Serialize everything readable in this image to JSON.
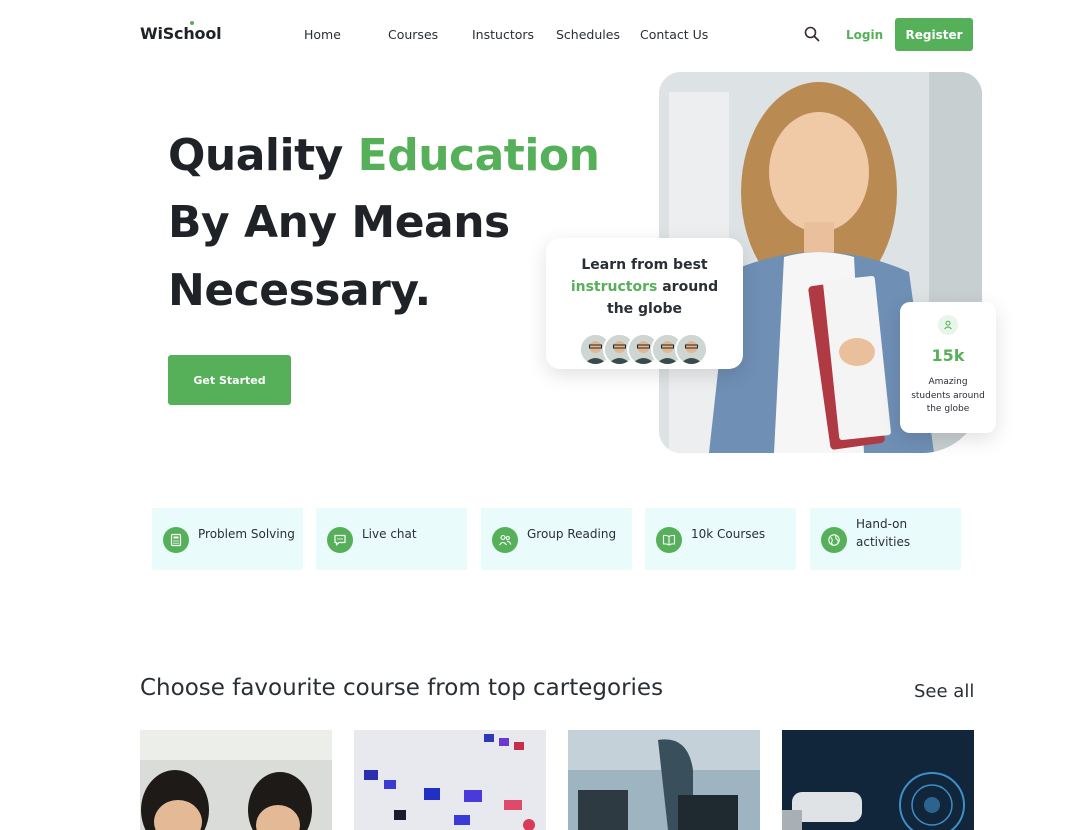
{
  "header": {
    "logo": "WiSchool",
    "nav": [
      "Home",
      "Courses",
      "Instuctors",
      "Schedules",
      "Contact Us"
    ],
    "login_label": "Login",
    "register_label": "Register",
    "search_icon": "search-icon"
  },
  "hero": {
    "line1_dark": "Quality",
    "line1_green": "Education",
    "line2": "By Any Means",
    "line3": "Necessary.",
    "cta_label": "Get Started",
    "learn_card": {
      "line1": "Learn from best",
      "line2_green": "instructors",
      "line2_dark": "around",
      "line3": "the globe",
      "avatars": 5
    },
    "stat_card": {
      "icon": "user-icon",
      "value": "15k",
      "desc_line1": "Amazing",
      "desc_line2": "students around",
      "desc_line3": "the globe"
    }
  },
  "features": [
    {
      "label": "Problem Solving",
      "icon": "calculator-icon"
    },
    {
      "label": "Live chat",
      "icon": "chat-icon"
    },
    {
      "label": "Group Reading",
      "icon": "users-icon"
    },
    {
      "label": "10k Courses",
      "icon": "book-icon"
    },
    {
      "label_line1": "Hand-on",
      "label_line2": "activities",
      "icon": "globe-icon"
    }
  ],
  "categories": {
    "title": "Choose favourite course from top cartegories",
    "see_all": "See all",
    "cards": [
      "students-photo",
      "design-board-photo",
      "workspace-photo",
      "vr-headset-photo"
    ]
  },
  "colors": {
    "accent": "#56b05a",
    "feature_bg": "#e9fbfb",
    "text": "#1f2328"
  }
}
